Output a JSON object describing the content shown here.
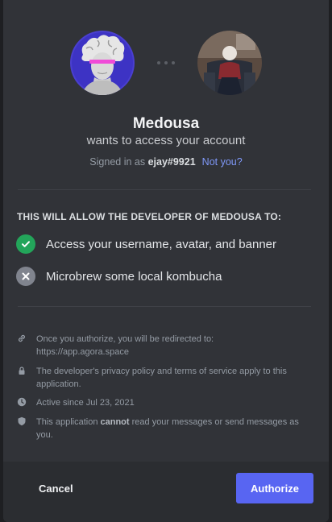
{
  "app": {
    "name": "Medousa",
    "subtitle": "wants to access your account"
  },
  "signin": {
    "prefix": "Signed in as ",
    "username": "ejay#9921",
    "not_you": "Not you?"
  },
  "permissions": {
    "title": "THIS WILL ALLOW THE DEVELOPER OF MEDOUSA TO:",
    "items": [
      {
        "label": "Access your username, avatar, and banner",
        "state": "allowed",
        "icon": "check-icon"
      },
      {
        "label": "Microbrew some local kombucha",
        "state": "denied",
        "icon": "x-icon"
      }
    ]
  },
  "info": {
    "redirect_line1": "Once you authorize, you will be redirected to:",
    "redirect_url": "https://app.agora.space",
    "privacy": "The developer's privacy policy and terms of service apply to this application.",
    "active_since": "Active since Jul 23, 2021",
    "cannot_prefix": "This application ",
    "cannot_bold": "cannot",
    "cannot_suffix": " read your messages or send messages as you."
  },
  "footer": {
    "cancel_label": "Cancel",
    "authorize_label": "Authorize"
  },
  "colors": {
    "accent": "#5865f2",
    "allowed": "#23a55a",
    "denied": "#80848e",
    "link": "#7f98f8"
  }
}
